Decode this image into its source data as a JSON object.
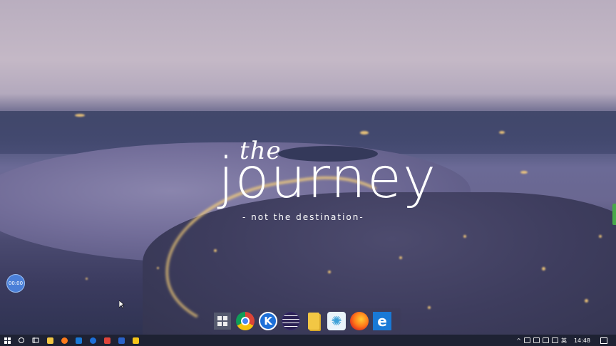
{
  "wallpaper": {
    "title_small": "the",
    "title_large": "journey",
    "subtitle": "- not the destination-"
  },
  "overlay": {
    "timer_text": "00:00"
  },
  "dock": {
    "items": [
      {
        "icon": "windows-grid-icon"
      },
      {
        "icon": "chrome-icon"
      },
      {
        "icon": "k-app-icon",
        "glyph": "K"
      },
      {
        "icon": "eclipse-icon"
      },
      {
        "icon": "sticky-notes-icon"
      },
      {
        "icon": "atom-app-icon"
      },
      {
        "icon": "firefox-icon"
      },
      {
        "icon": "edge-icon",
        "glyph": "e"
      }
    ]
  },
  "taskbar": {
    "pinned": [
      {
        "icon": "file-explorer-icon",
        "color": "#f2c744"
      },
      {
        "icon": "firefox-icon",
        "color": "#ff7a1a"
      },
      {
        "icon": "edge-icon",
        "color": "#1979d6"
      },
      {
        "icon": "k-app-icon",
        "color": "#1d6fd8"
      },
      {
        "icon": "app-red-icon",
        "color": "#e0443a"
      },
      {
        "icon": "wps-icon",
        "color": "#2a62c9"
      },
      {
        "icon": "app-yellow-icon",
        "color": "#f5c518"
      }
    ],
    "tray": {
      "ime": "英",
      "time": "14:48"
    }
  },
  "colors": {
    "taskbar_bg": "#1e2233",
    "accent": "#4a7fd8"
  }
}
